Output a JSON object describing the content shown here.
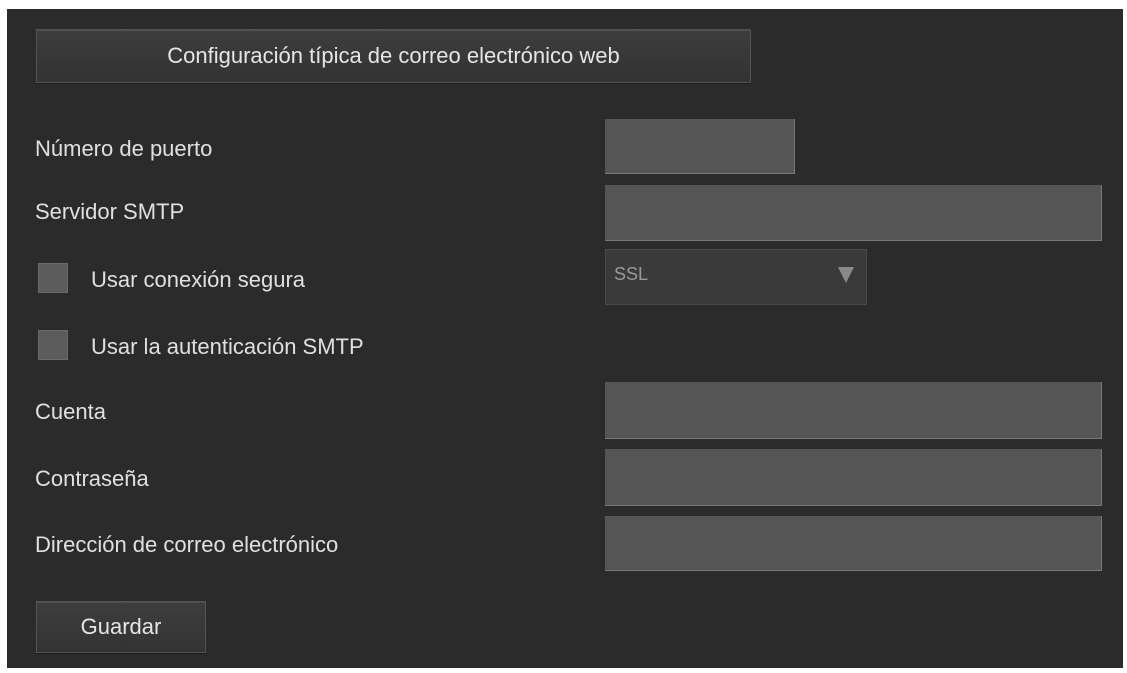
{
  "typical_config_button": "Configuración típica de correo electrónico web",
  "fields": {
    "port_label": "Número de puerto",
    "smtp_server_label": "Servidor SMTP",
    "secure_connection_label": "Usar conexión segura",
    "smtp_auth_label": "Usar la autenticación SMTP",
    "account_label": "Cuenta",
    "password_label": "Contraseña",
    "email_label": "Dirección de correo electrónico"
  },
  "security_select": {
    "selected": "SSL"
  },
  "save_button": "Guardar",
  "colors": {
    "panel_bg": "#2b2b2b",
    "field_bg": "#555555",
    "text": "#e0e0e0"
  }
}
